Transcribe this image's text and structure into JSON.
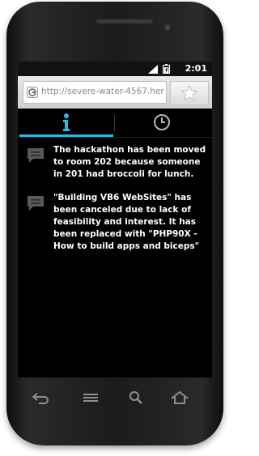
{
  "status_bar": {
    "time": "2:01",
    "icons": [
      "signal-icon",
      "battery-icon"
    ]
  },
  "browser": {
    "url": "http://severe-water-4567.hero...",
    "icons": [
      "globe-icon",
      "star-icon"
    ]
  },
  "tabs": [
    {
      "icon": "info-icon",
      "selected": true
    },
    {
      "icon": "clock-icon",
      "selected": false
    }
  ],
  "messages": [
    {
      "icon": "chat-bubble-icon",
      "text": "The hackathon has been moved to room 202 because someone in 201 had broccoli for lunch."
    },
    {
      "icon": "chat-bubble-icon",
      "text": "\"Building VB6 WebSites\" has been canceled due to lack of feasibility and interest. It has been replaced with \"PHP90X - How to build apps and biceps\""
    }
  ],
  "navigation": [
    "back-icon",
    "menu-icon",
    "search-icon",
    "home-icon"
  ],
  "colors": {
    "accent": "#33b5e5",
    "screen_bg": "#000000",
    "text": "#ffffff"
  }
}
